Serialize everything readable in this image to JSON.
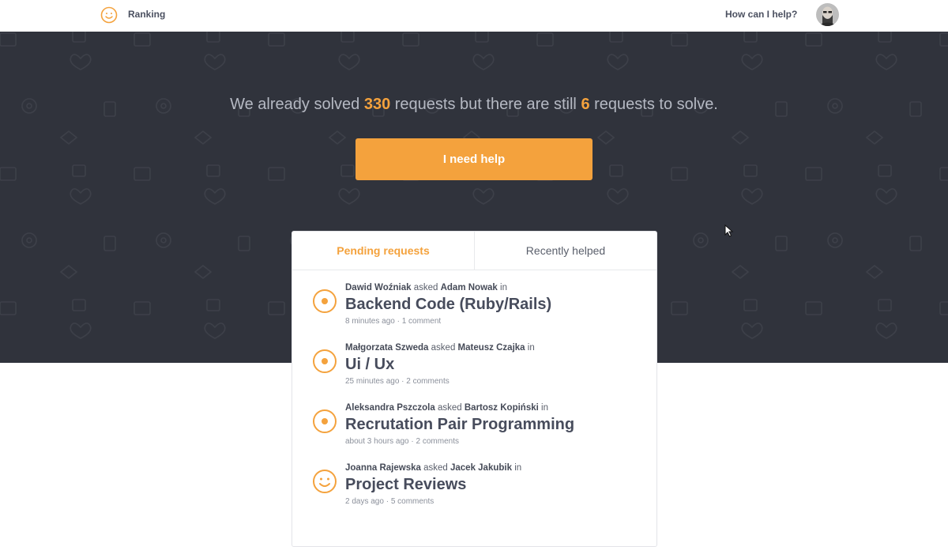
{
  "header": {
    "brand": "Ranking",
    "help_link": "How can I help?",
    "logo_icon": "smiley-icon",
    "accent": "#f4a23d"
  },
  "hero": {
    "text_1": "We already solved ",
    "solved_count": "330",
    "text_2": " requests but there are still ",
    "pending_count": "6",
    "text_3": " requests to solve.",
    "button_label": "I need help",
    "background": "#30333c"
  },
  "tabs": {
    "pending": "Pending requests",
    "recent": "Recently helped"
  },
  "requests": [
    {
      "asker": "Dawid Woźniak",
      "asked": "asked",
      "helper": "Adam Nowak",
      "in": "in",
      "topic": "Backend Code (Ruby/Rails)",
      "meta": "8 minutes ago · 1 comment",
      "icon": "target-circle-icon"
    },
    {
      "asker": "Małgorzata Szweda",
      "asked": "asked",
      "helper": "Mateusz Czajka",
      "in": "in",
      "topic": "Ui / Ux",
      "meta": "25 minutes ago · 2 comments",
      "icon": "target-circle-icon"
    },
    {
      "asker": "Aleksandra Pszczola",
      "asked": "asked",
      "helper": "Bartosz Kopiński",
      "in": "in",
      "topic": "Recrutation Pair Programming",
      "meta": "about 3 hours ago · 2 comments",
      "icon": "target-circle-icon"
    },
    {
      "asker": "Joanna Rajewska",
      "asked": "asked",
      "helper": "Jacek Jakubik",
      "in": "in",
      "topic": "Project Reviews",
      "meta": "2 days ago · 5 comments",
      "icon": "smiley-icon"
    }
  ]
}
